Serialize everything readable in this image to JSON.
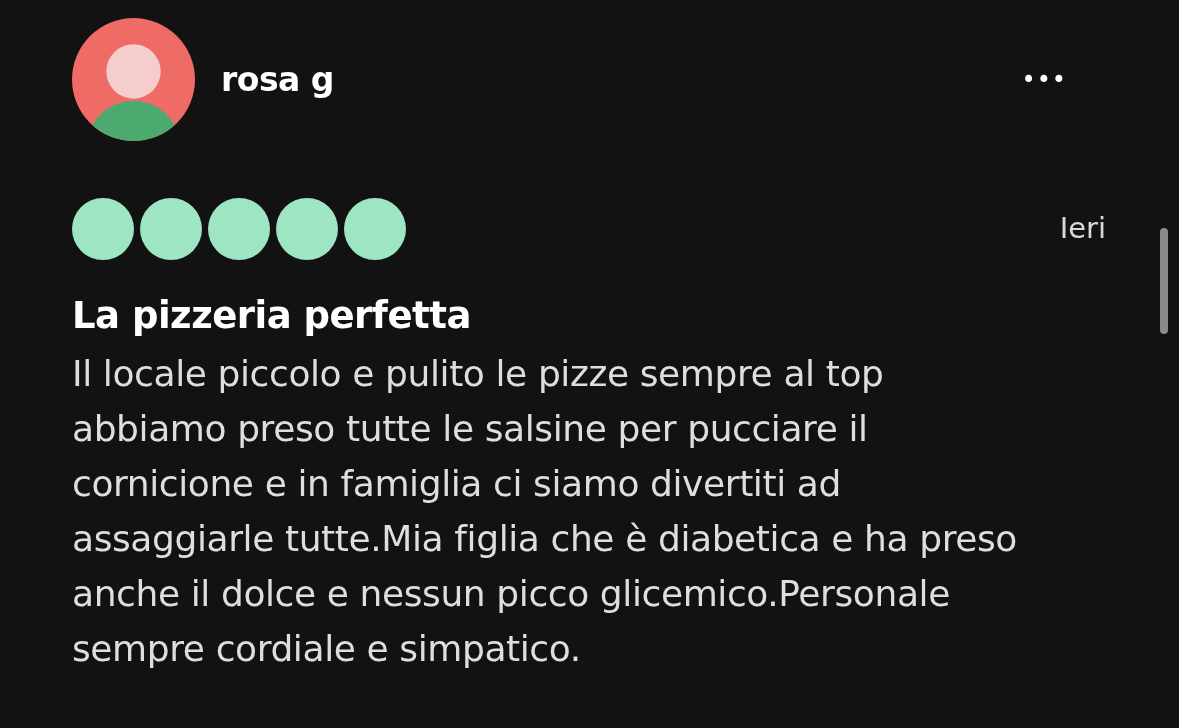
{
  "review": {
    "author": "rosa g",
    "more_menu": "•••",
    "rating": {
      "stars": 5
    },
    "date": "Ieri",
    "title": "La pizzeria perfetta",
    "body": "Il locale piccolo e pulito le pizze sempre al top abbiamo preso tutte le salsine per pucciare il cornicione e in famiglia ci siamo divertiti ad assaggiarle tutte.Mia figlia che è diabetica e ha preso anche il dolce e nessun picco glicemico.Personale sempre cordiale e simpatico."
  }
}
